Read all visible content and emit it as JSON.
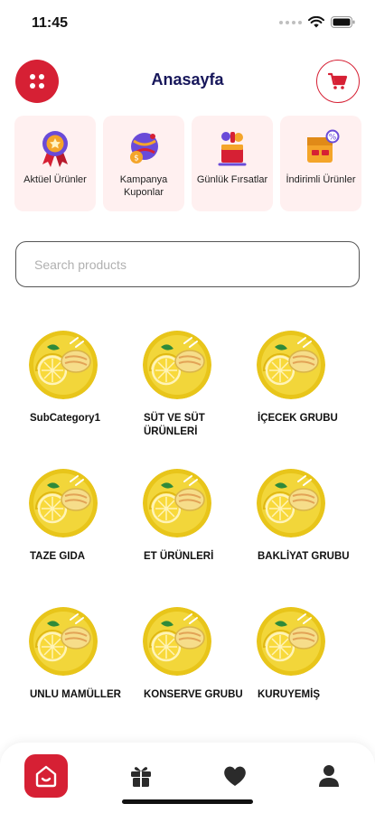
{
  "status_bar": {
    "time": "11:45"
  },
  "header": {
    "title": "Anasayfa"
  },
  "quick_tiles": [
    {
      "label": "Aktüel Ürünler",
      "icon": "award-ribbon-icon"
    },
    {
      "label": "Kampanya Kuponlar",
      "icon": "coupon-globe-icon"
    },
    {
      "label": "Günlük Fırsatlar",
      "icon": "daily-deals-icon"
    },
    {
      "label": "İndirimli Ürünler",
      "icon": "discount-box-icon"
    }
  ],
  "search": {
    "placeholder": "Search products",
    "value": ""
  },
  "categories": [
    {
      "label": "SubCategory1"
    },
    {
      "label": "SÜT VE SÜT ÜRÜNLERİ"
    },
    {
      "label": "İÇECEK GRUBU"
    },
    {
      "label": "TAZE GIDA"
    },
    {
      "label": "ET ÜRÜNLERİ"
    },
    {
      "label": "BAKLİYAT GRUBU"
    },
    {
      "label": "UNLU MAMÜLLER"
    },
    {
      "label": "KONSERVE GRUBU"
    },
    {
      "label": "KURUYEMİŞ"
    }
  ],
  "bottom_nav": [
    {
      "name": "home",
      "icon": "home-icon",
      "active": true
    },
    {
      "name": "gifts",
      "icon": "gift-icon",
      "active": false
    },
    {
      "name": "favorites",
      "icon": "heart-icon",
      "active": false
    },
    {
      "name": "profile",
      "icon": "user-icon",
      "active": false
    }
  ],
  "colors": {
    "accent": "#d62034",
    "tile_bg": "#fff0f0",
    "title": "#16165a"
  }
}
